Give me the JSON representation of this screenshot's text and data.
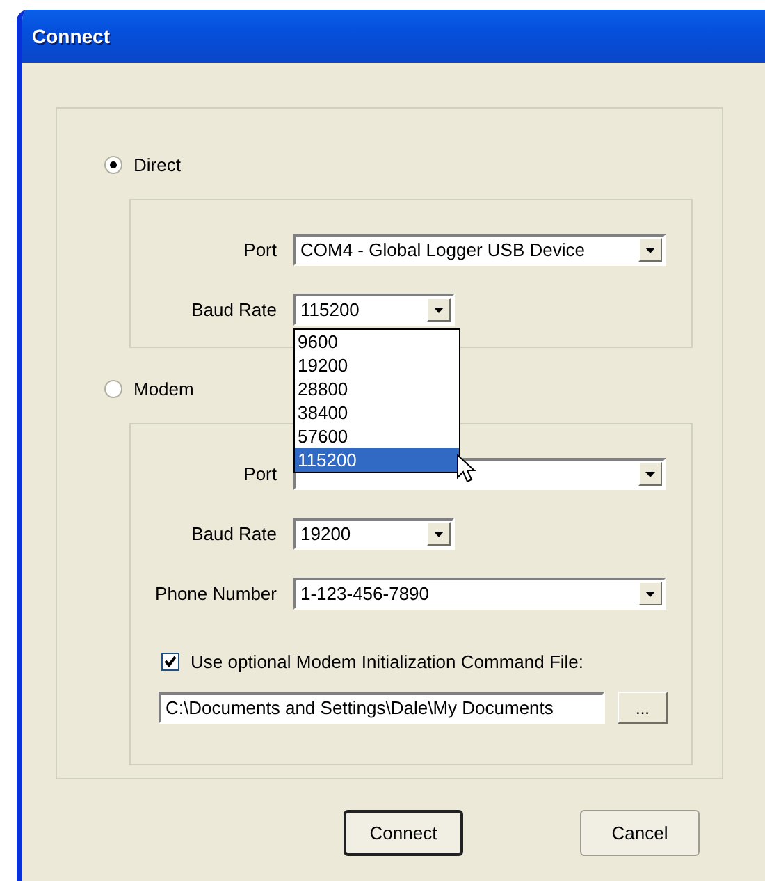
{
  "window": {
    "title": "Connect"
  },
  "sections": [
    {
      "radio": {
        "label": "Direct",
        "selected": true
      },
      "fields": [
        {
          "label": "Port",
          "value": "COM4 - Global Logger USB Device",
          "kind": "port"
        },
        {
          "label": "Baud Rate",
          "value": "115200",
          "kind": "baud",
          "dropdown": {
            "options": [
              {
                "label": "9600",
                "selected": false
              },
              {
                "label": "19200",
                "selected": false
              },
              {
                "label": "28800",
                "selected": false
              },
              {
                "label": "38400",
                "selected": false
              },
              {
                "label": "57600",
                "selected": false
              },
              {
                "label": "115200",
                "selected": true
              }
            ]
          }
        }
      ]
    },
    {
      "radio": {
        "label": "Modem",
        "selected": false
      },
      "fields": [
        {
          "label": "Port",
          "kind": "port"
        },
        {
          "label": "Baud Rate",
          "value": "19200",
          "kind": "baud"
        },
        {
          "label": "Phone Number",
          "value": "1-123-456-7890",
          "kind": "phone"
        }
      ],
      "init_file": {
        "label": "Use optional Modem Initialization Command File:",
        "checked": true,
        "path": "C:\\Documents and Settings\\Dale\\My Documents",
        "browse": "..."
      }
    }
  ],
  "buttons": [
    {
      "label": "Connect",
      "default": true
    },
    {
      "label": "Cancel",
      "default": false
    }
  ]
}
